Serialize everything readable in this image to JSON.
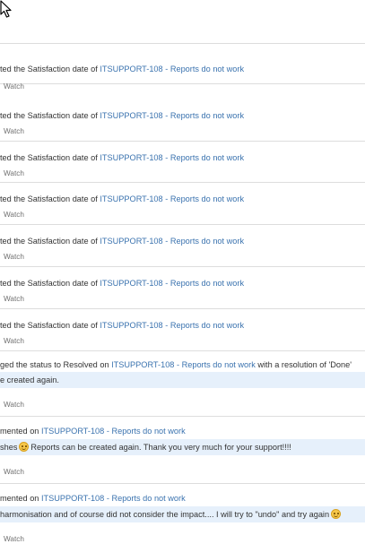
{
  "activity": {
    "watch_label": "Watch",
    "items": [
      {
        "prefix": "ted the Satisfaction date of ",
        "issue_key": "ITSUPPORT-108",
        "issue_title": " - Reports do not work",
        "suffix": ""
      },
      {
        "prefix": "ted the Satisfaction date of ",
        "issue_key": "ITSUPPORT-108",
        "issue_title": " - Reports do not work",
        "suffix": ""
      },
      {
        "prefix": "ted the Satisfaction date of ",
        "issue_key": "ITSUPPORT-108",
        "issue_title": " - Reports do not work",
        "suffix": ""
      },
      {
        "prefix": "ted the Satisfaction date of ",
        "issue_key": "ITSUPPORT-108",
        "issue_title": " - Reports do not work",
        "suffix": ""
      },
      {
        "prefix": "ted the Satisfaction date of ",
        "issue_key": "ITSUPPORT-108",
        "issue_title": " - Reports do not work",
        "suffix": ""
      },
      {
        "prefix": "ted the Satisfaction date of ",
        "issue_key": "ITSUPPORT-108",
        "issue_title": " - Reports do not work",
        "suffix": ""
      },
      {
        "prefix": "ted the Satisfaction date of ",
        "issue_key": "ITSUPPORT-108",
        "issue_title": " - Reports do not work",
        "suffix": ""
      },
      {
        "prefix": "ged the status to Resolved on ",
        "issue_key": "ITSUPPORT-108",
        "issue_title": " - Reports do not work",
        "suffix": " with a resolution of 'Done'",
        "comment_before": "e created again.",
        "comment_after": ""
      },
      {
        "prefix": "mented on ",
        "issue_key": "ITSUPPORT-108",
        "issue_title": " - Reports do not work",
        "suffix": "",
        "comment_before": "shes",
        "comment_after": "Reports can be created again. Thank you very much for your support!!!!"
      },
      {
        "prefix": "mented on ",
        "issue_key": "ITSUPPORT-108",
        "issue_title": " - Reports do not work",
        "suffix": "",
        "comment_before": "harmonisation and of course did not consider the impact.... I will try to \"undo\" and try again",
        "comment_after": ""
      }
    ]
  }
}
